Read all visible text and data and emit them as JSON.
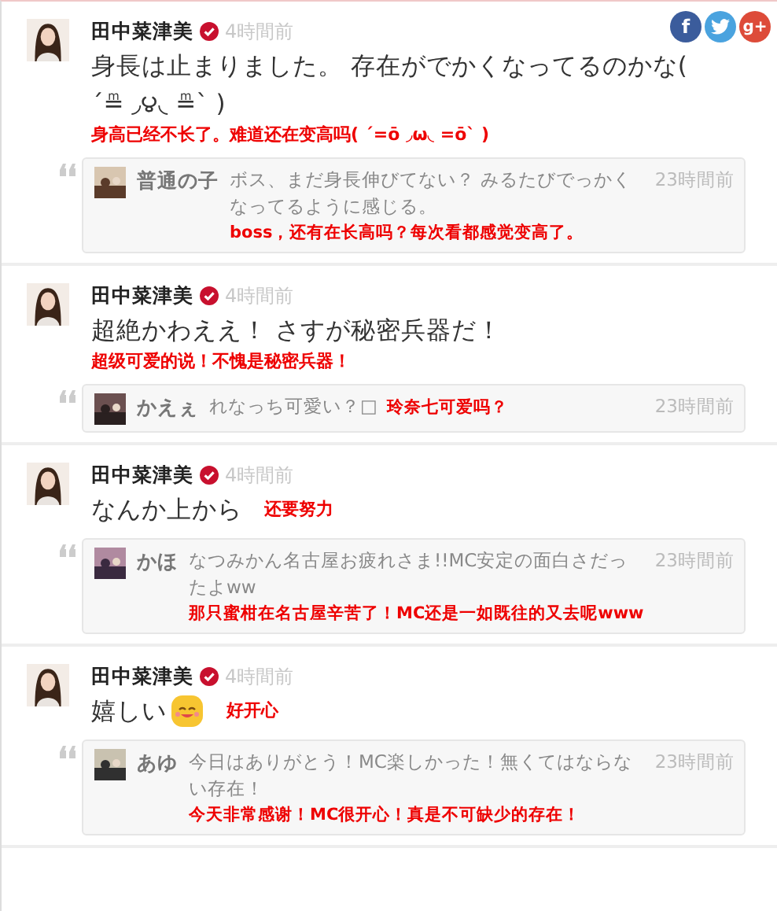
{
  "share_buttons": [
    {
      "kind": "facebook",
      "label": "f"
    },
    {
      "kind": "twitter"
    },
    {
      "kind": "googleplus",
      "label": "g+"
    }
  ],
  "posts": [
    {
      "author": "田中菜津美",
      "verified": true,
      "time": "4時間前",
      "body": "身長は止まりました。 存在がでかくなってるのかな( ´≞ ◞౪◟ ≞` )",
      "translation": "身高已经不长了。难道还在变高吗( ´=ō ◞ω◟ =ō` )",
      "reply": {
        "name": "普通の子",
        "text": "ボス、まだ身長伸びてない？ みるたびでっかくなってるように感じる。",
        "time": "23時間前",
        "translation": "boss，还有在长高吗？每次看都感觉变高了。"
      }
    },
    {
      "author": "田中菜津美",
      "verified": true,
      "time": "4時間前",
      "body": "超絶かわええ！ さすが秘密兵器だ！",
      "translation": "超级可爱的说！不愧是秘密兵器！",
      "reply": {
        "name": "かえぇ",
        "text": "れなっち可愛い？□",
        "time": "23時間前",
        "translation": "玲奈七可爱吗？"
      }
    },
    {
      "author": "田中菜津美",
      "verified": true,
      "time": "4時間前",
      "body": "なんか上から",
      "translation": "还要努力",
      "reply": {
        "name": "かほ",
        "text": "なつみかん名古屋お疲れさま!!MC安定の面白さだったよww",
        "time": "23時間前",
        "translation": "那只蜜柑在名古屋辛苦了！MC还是一如既往的又去呢www"
      }
    },
    {
      "author": "田中菜津美",
      "verified": true,
      "time": "4時間前",
      "body": "嬉しい",
      "emoji": true,
      "translation": "好开心",
      "reply": {
        "name": "あゆ",
        "text": "今日はありがとう！MC楽しかった！無くてはならない存在！",
        "time": "23時間前",
        "translation": "今天非常感谢！MC很开心！真是不可缺少的存在！"
      }
    }
  ]
}
